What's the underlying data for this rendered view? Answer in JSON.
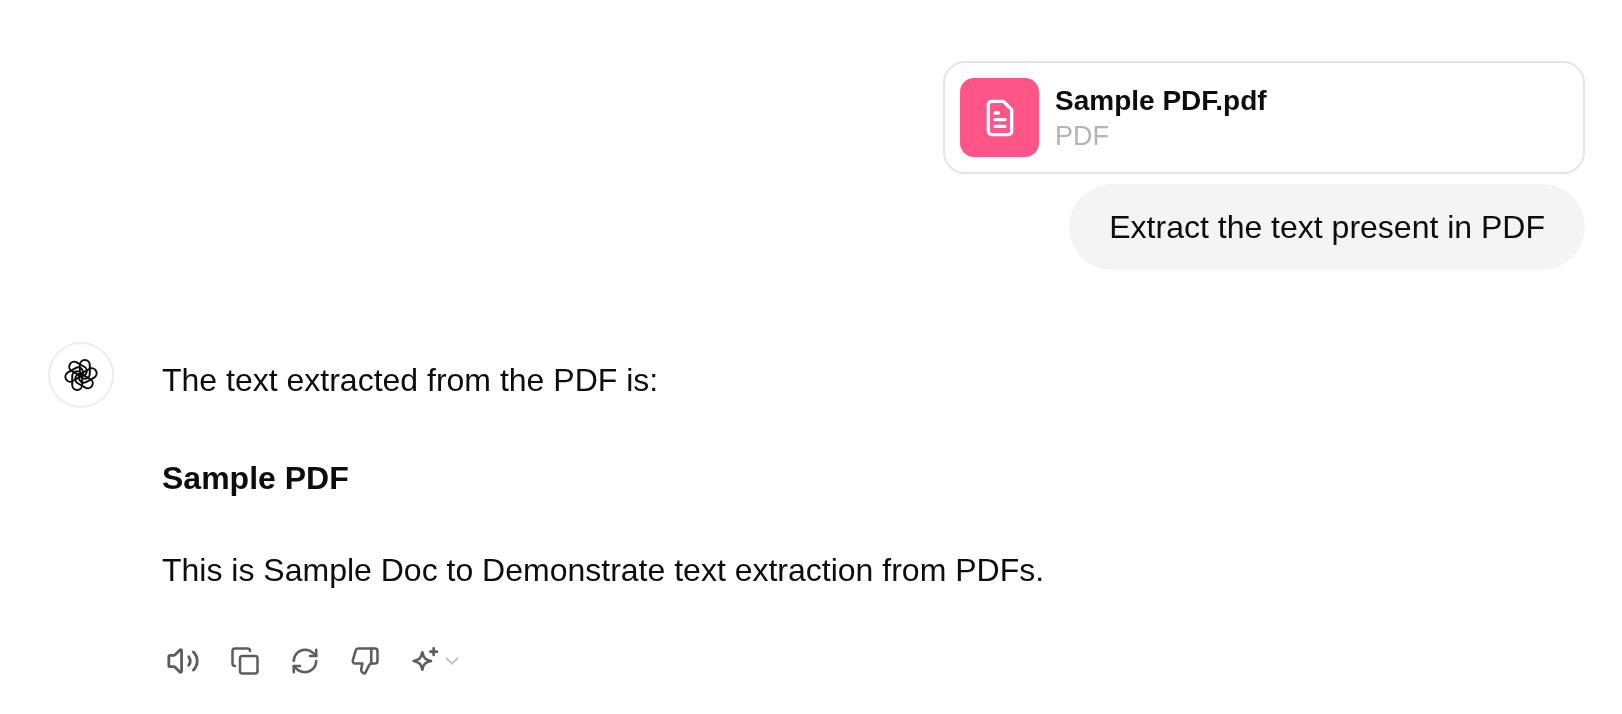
{
  "attachment": {
    "file_name": "Sample PDF.pdf",
    "file_type": "PDF"
  },
  "user_message": {
    "text": "Extract the text present in PDF"
  },
  "assistant": {
    "blocks": [
      {
        "kind": "paragraph",
        "text": "The text extracted from the PDF is:"
      },
      {
        "kind": "heading",
        "text": "Sample PDF"
      },
      {
        "kind": "paragraph",
        "text": "This is Sample Doc to Demonstrate text extraction from PDFs."
      }
    ]
  }
}
